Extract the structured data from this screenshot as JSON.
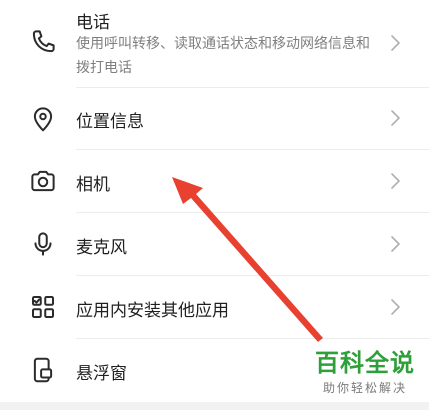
{
  "permissions": [
    {
      "name": "电话",
      "description": "使用呼叫转移、读取通话状态和移动网络信息和拨打电话",
      "icon": "phone-icon"
    },
    {
      "name": "位置信息",
      "icon": "location-pin-icon"
    },
    {
      "name": "相机",
      "icon": "camera-icon"
    },
    {
      "name": "麦克风",
      "icon": "microphone-icon"
    },
    {
      "name": "应用内安装其他应用",
      "icon": "apps-grid-icon"
    },
    {
      "name": "悬浮窗",
      "icon": "floating-window-icon"
    }
  ],
  "annotation": {
    "color": "#e8412f",
    "description": "red arrow pointing to camera row"
  },
  "watermark": {
    "title": "百科全说",
    "subtitle": "助你轻松解决",
    "color": "#2f9f3a"
  }
}
